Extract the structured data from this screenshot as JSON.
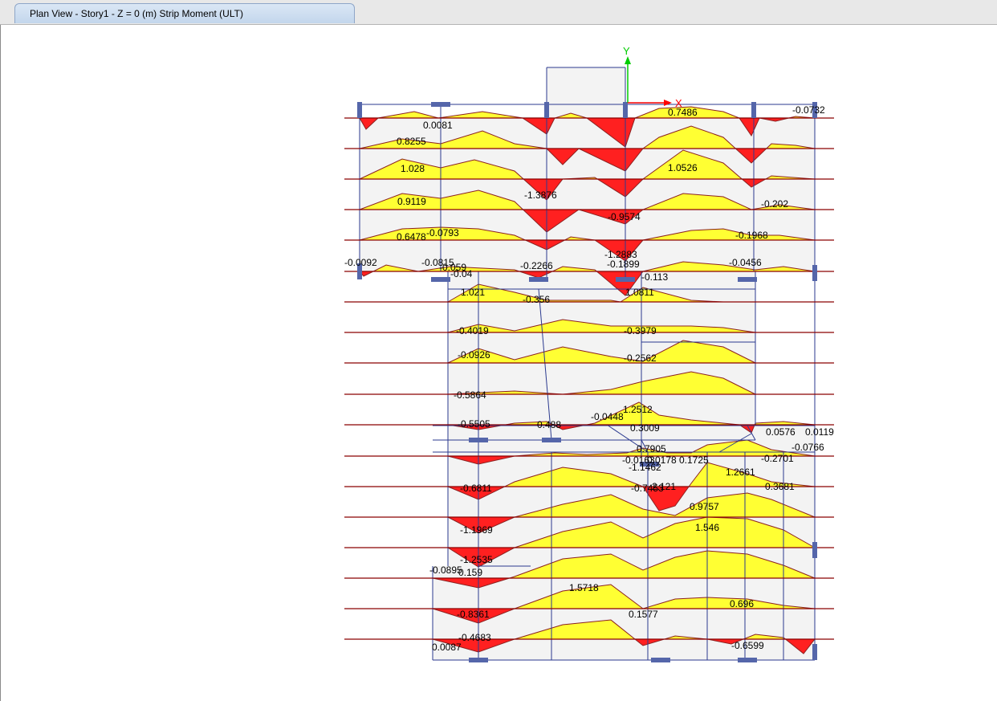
{
  "tab": {
    "title": "Plan View - Story1 - Z = 0 (m)   Strip Moment  (ULT)"
  },
  "axes": {
    "x_label": "X",
    "y_label": "Y"
  },
  "colors": {
    "positive": "#ffff33",
    "negative": "#ff2020",
    "strip_line": "#8b0000",
    "grid": "#2b3a8f",
    "column": "#5566aa",
    "axis_x": "#ff0000",
    "axis_y": "#00cc00"
  },
  "labels": [
    "0.0081",
    "0.7486",
    "-0.0732",
    "0.8255",
    "1.028",
    "1.0526",
    "-1.3876",
    "0.9119",
    "-0.9574",
    "-0.202",
    "0.6478",
    "-0.0793",
    "-0.1968",
    "-1.2883",
    "-0.0092",
    "-0.0815",
    "-0.059",
    "-0.2266",
    "-0.1899",
    "-0.0456",
    "-0.04",
    "-0.113",
    "1.021",
    "-0.356",
    "1.0811",
    "-0.4019",
    "-0.3979",
    "-0.0926",
    "-0.2562",
    "-0.5864",
    "1.2512",
    "-0.0448",
    "-0.5505",
    "0.488",
    "0.3009",
    "0.0576",
    "0.0119",
    "0.7905",
    "-0.0766",
    "-0.0163",
    "0.0178",
    "0.1725",
    "-0.2701",
    "-1.1462",
    "1.2661",
    "-0.6811",
    "-0.7453",
    "2.121",
    "0.3681",
    "0.9757",
    "-1.1969",
    "1.546",
    "-1.2535",
    "-0.0895",
    "0.159",
    "1.5718",
    "0.696",
    "-0.8361",
    "0.1577",
    "-0.4683",
    "0.0087",
    "-0.6599"
  ]
}
